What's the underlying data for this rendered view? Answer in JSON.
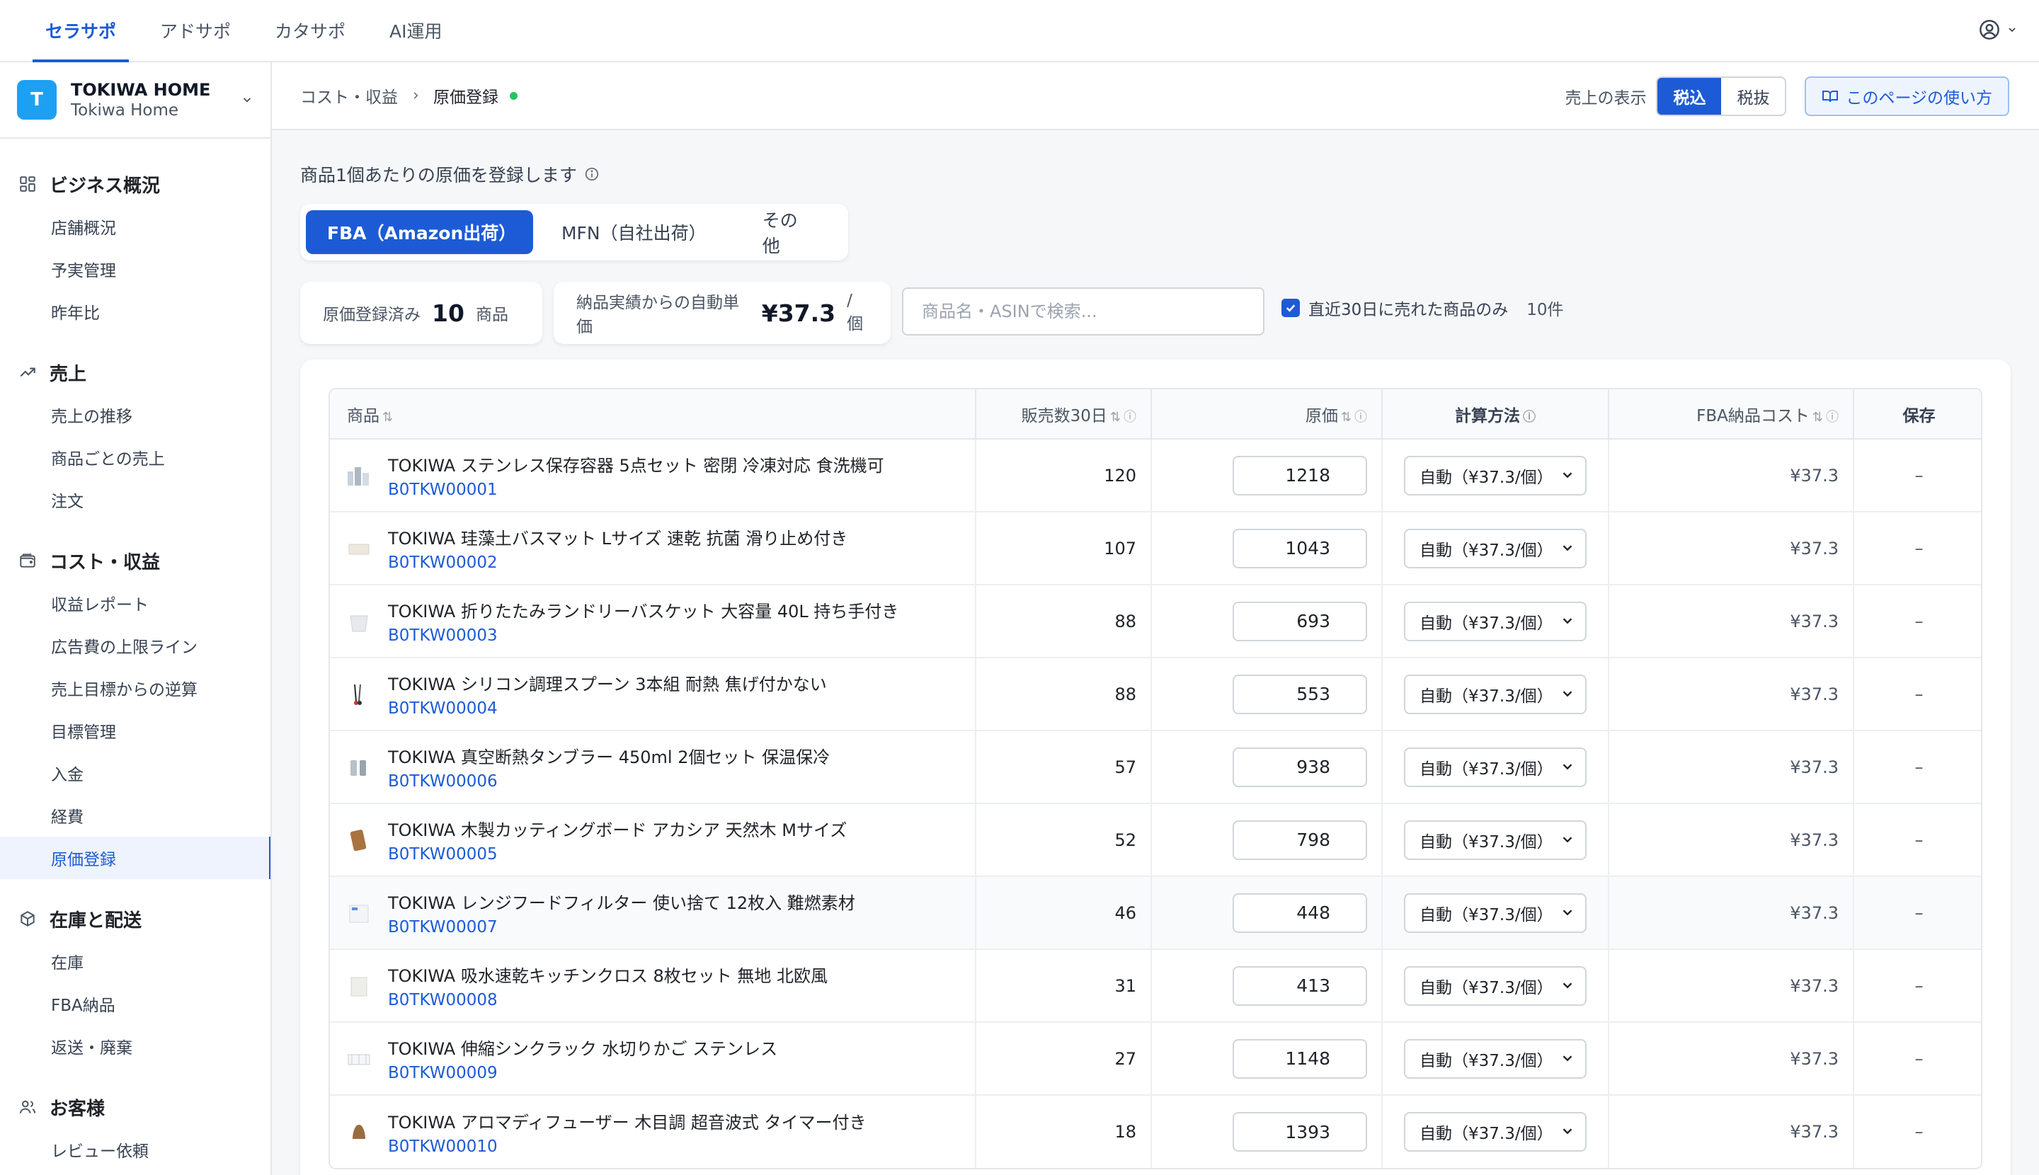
{
  "topnav": {
    "tabs": [
      "セラサポ",
      "アドサポ",
      "カタサポ",
      "AI運用"
    ],
    "active_index": 0
  },
  "store": {
    "initial": "T",
    "name": "TOKIWA HOME",
    "subname": "Tokiwa Home"
  },
  "sidebar": {
    "groups": [
      {
        "label": "ビジネス概況",
        "icon": "dashboard-grid-icon",
        "items": [
          "店舗概況",
          "予実管理",
          "昨年比"
        ]
      },
      {
        "label": "売上",
        "icon": "trend-up-icon",
        "items": [
          "売上の推移",
          "商品ごとの売上",
          "注文"
        ]
      },
      {
        "label": "コスト・収益",
        "icon": "wallet-icon",
        "items": [
          "収益レポート",
          "広告費の上限ライン",
          "売上目標からの逆算",
          "目標管理",
          "入金",
          "経費",
          "原価登録"
        ]
      },
      {
        "label": "在庫と配送",
        "icon": "box-icon",
        "items": [
          "在庫",
          "FBA納品",
          "返送・廃棄"
        ]
      },
      {
        "label": "お客様",
        "icon": "users-icon",
        "items": [
          "レビュー依頼"
        ]
      }
    ],
    "active_item": "原価登録"
  },
  "header": {
    "breadcrumb": [
      "コスト・収益",
      "原価登録"
    ],
    "tax_label": "売上の表示",
    "tax_options": [
      "税込",
      "税抜"
    ],
    "tax_selected": "税込",
    "help_label": "このページの使い方"
  },
  "intro": "商品1個あたりの原価を登録します",
  "type_tabs": [
    "FBA（Amazon出荷）",
    "MFN（自社出荷）",
    "その他"
  ],
  "type_selected": "FBA（Amazon出荷）",
  "stats": {
    "registered_label": "原価登録済み",
    "registered_value": "10",
    "registered_unit": "商品",
    "auto_label": "納品実績からの自動単価",
    "auto_value": "¥37.3",
    "auto_unit": "/個"
  },
  "search": {
    "placeholder": "商品名・ASINで検索...",
    "value": ""
  },
  "filter": {
    "label": "直近30日に売れた商品のみ",
    "checked": true,
    "count": "10件"
  },
  "table": {
    "headers": [
      "商品",
      "販売数30日",
      "原価",
      "計算方法",
      "FBA納品コスト",
      "保存"
    ],
    "rows": [
      {
        "name": "TOKIWA ステンレス保存容器 5点セット 密閉 冷凍対応 食洗機可",
        "asin": "B0TKW00001",
        "sales": "120",
        "cost": "1218",
        "method": "自動（¥37.3/個）",
        "fba": "¥37.3",
        "save": "–",
        "thumb": "containers"
      },
      {
        "name": "TOKIWA 珪藻土バスマット Lサイズ 速乾 抗菌 滑り止め付き",
        "asin": "B0TKW00002",
        "sales": "107",
        "cost": "1043",
        "method": "自動（¥37.3/個）",
        "fba": "¥37.3",
        "save": "–",
        "thumb": "mat"
      },
      {
        "name": "TOKIWA 折りたたみランドリーバスケット 大容量 40L 持ち手付き",
        "asin": "B0TKW00003",
        "sales": "88",
        "cost": "693",
        "method": "自動（¥37.3/個）",
        "fba": "¥37.3",
        "save": "–",
        "thumb": "basket"
      },
      {
        "name": "TOKIWA シリコン調理スプーン 3本組 耐熱 焦げ付かない",
        "asin": "B0TKW00004",
        "sales": "88",
        "cost": "553",
        "method": "自動（¥37.3/個）",
        "fba": "¥37.3",
        "save": "–",
        "thumb": "spoons"
      },
      {
        "name": "TOKIWA 真空断熱タンブラー 450ml 2個セット 保温保冷",
        "asin": "B0TKW00006",
        "sales": "57",
        "cost": "938",
        "method": "自動（¥37.3/個）",
        "fba": "¥37.3",
        "save": "–",
        "thumb": "tumblers"
      },
      {
        "name": "TOKIWA 木製カッティングボード アカシア 天然木 Mサイズ",
        "asin": "B0TKW00005",
        "sales": "52",
        "cost": "798",
        "method": "自動（¥37.3/個）",
        "fba": "¥37.3",
        "save": "–",
        "thumb": "board"
      },
      {
        "name": "TOKIWA レンジフードフィルター 使い捨て 12枚入 難燃素材",
        "asin": "B0TKW00007",
        "sales": "46",
        "cost": "448",
        "method": "自動（¥37.3/個）",
        "fba": "¥37.3",
        "save": "–",
        "thumb": "filter"
      },
      {
        "name": "TOKIWA 吸水速乾キッチンクロス 8枚セット 無地 北欧風",
        "asin": "B0TKW00008",
        "sales": "31",
        "cost": "413",
        "method": "自動（¥37.3/個）",
        "fba": "¥37.3",
        "save": "–",
        "thumb": "cloth"
      },
      {
        "name": "TOKIWA 伸縮シンクラック 水切りかご ステンレス",
        "asin": "B0TKW00009",
        "sales": "27",
        "cost": "1148",
        "method": "自動（¥37.3/個）",
        "fba": "¥37.3",
        "save": "–",
        "thumb": "rack"
      },
      {
        "name": "TOKIWA アロマディフューザー 木目調 超音波式 タイマー付き",
        "asin": "B0TKW00010",
        "sales": "18",
        "cost": "1393",
        "method": "自動（¥37.3/個）",
        "fba": "¥37.3",
        "save": "–",
        "thumb": "diffuser"
      }
    ]
  },
  "colors": {
    "accent": "#1d5bd6",
    "avatar": "#1ea0f2",
    "status_dot": "#22c55e"
  }
}
